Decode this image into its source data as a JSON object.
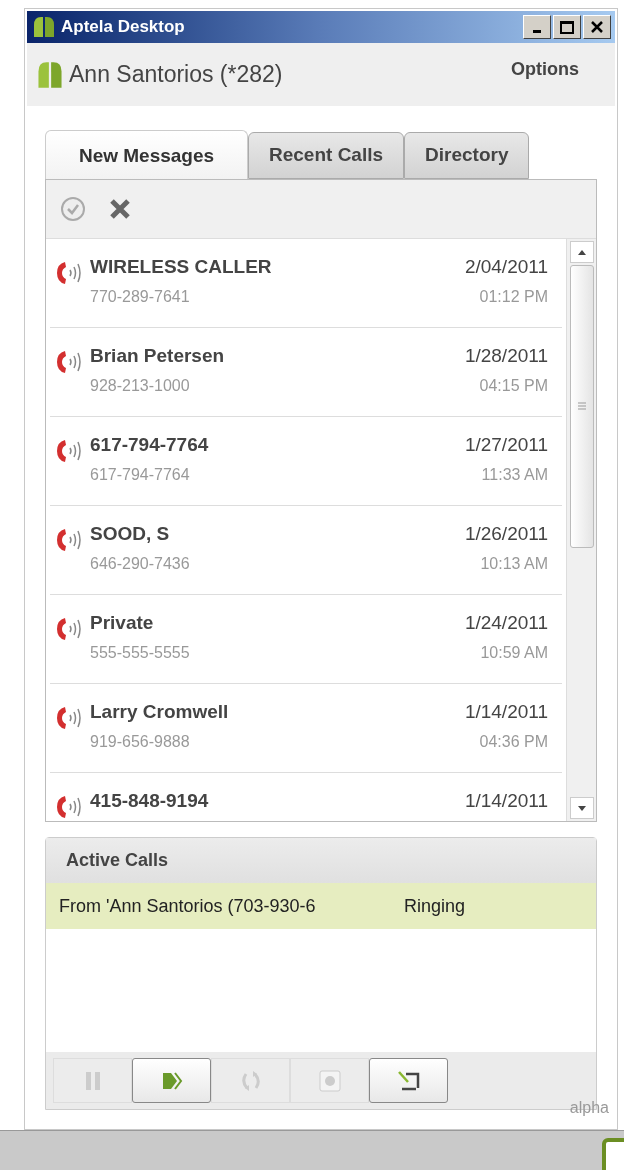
{
  "window": {
    "title": "Aptela Desktop"
  },
  "header": {
    "user": "Ann Santorios (*282)",
    "options": "Options"
  },
  "tabs": [
    {
      "label": "New Messages",
      "selected": true
    },
    {
      "label": "Recent Calls",
      "selected": false
    },
    {
      "label": "Directory",
      "selected": false
    }
  ],
  "messages": [
    {
      "name": "WIRELESS CALLER",
      "number": "770-289-7641",
      "date": "2/04/2011",
      "time": "01:12 PM"
    },
    {
      "name": "Brian Petersen",
      "number": "928-213-1000",
      "date": "1/28/2011",
      "time": "04:15 PM"
    },
    {
      "name": "617-794-7764",
      "number": "617-794-7764",
      "date": "1/27/2011",
      "time": "11:33 AM"
    },
    {
      "name": "SOOD, S",
      "number": "646-290-7436",
      "date": "1/26/2011",
      "time": "10:13 AM"
    },
    {
      "name": "Private",
      "number": "555-555-5555",
      "date": "1/24/2011",
      "time": "10:59 AM"
    },
    {
      "name": "Larry Cromwell",
      "number": "919-656-9888",
      "date": "1/14/2011",
      "time": "04:36 PM"
    },
    {
      "name": "415-848-9194",
      "date": "1/14/2011"
    }
  ],
  "active_calls": {
    "title": "Active Calls",
    "calls": [
      {
        "caller": "From 'Ann Santorios (703-930-6",
        "status": "Ringing"
      }
    ]
  },
  "call_buttons": [
    {
      "kind": "hold",
      "disabled": true
    },
    {
      "kind": "answer",
      "disabled": false
    },
    {
      "kind": "transfer",
      "disabled": true
    },
    {
      "kind": "record",
      "disabled": true
    },
    {
      "kind": "note",
      "disabled": false
    }
  ],
  "footer": {
    "version": "alpha"
  }
}
